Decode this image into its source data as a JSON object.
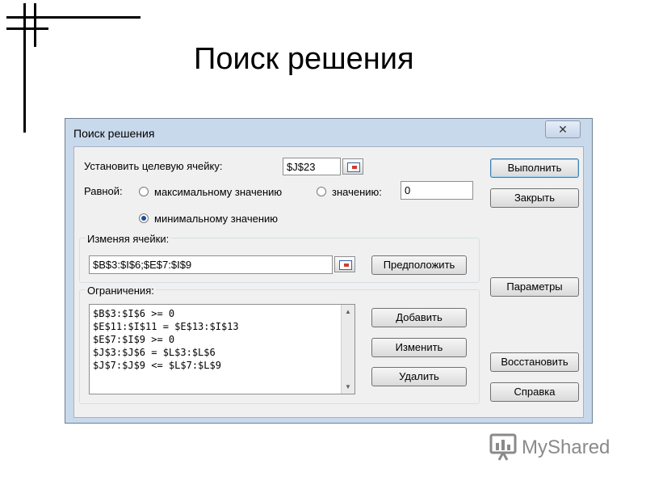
{
  "slide": {
    "title": "Поиск решения",
    "logo_text": "MyShared"
  },
  "dialog": {
    "title": "Поиск решения",
    "close_glyph": "✕",
    "target_label": "Установить целевую ячейку:",
    "target_value": "$J$23",
    "equal_label": "Равной:",
    "radio_max_label": "максимальному значению",
    "radio_value_label": "значению:",
    "value_field": "0",
    "radio_min_label": "минимальному значению",
    "selected_option": "минимальному значению",
    "changing_label": "Изменяя ячейки:",
    "changing_value": "$B$3:$I$6;$E$7:$I$9",
    "guess_button": "Предположить",
    "constraints_label": "Ограничения:",
    "constraints": [
      "$B$3:$I$6 >= 0",
      "$E$11:$I$11 = $E$13:$I$13",
      "$E$7:$I$9 >= 0",
      "$J$3:$J$6 = $L$3:$L$6",
      "$J$7:$J$9 <= $L$7:$L$9"
    ],
    "add_button": "Добавить",
    "change_button": "Изменить",
    "delete_button": "Удалить",
    "solve_button": "Выполнить",
    "close_button": "Закрыть",
    "options_button": "Параметры",
    "reset_button": "Восстановить",
    "help_button": "Справка"
  },
  "colors": {
    "dialog_frame": "#c9d9ec",
    "client_bg": "#f0f0f0",
    "radio_dot": "#1f4e9a"
  }
}
